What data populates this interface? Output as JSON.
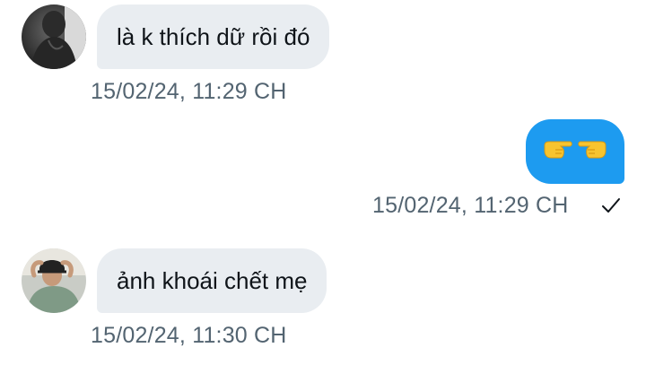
{
  "messages": [
    {
      "direction": "incoming",
      "text": "là k thích dữ rồi đó",
      "timestamp": "15/02/24, 11:29 CH",
      "avatar": "avatar-photo"
    },
    {
      "direction": "outgoing",
      "text": "",
      "emojis": [
        "backhand-index-pointing-right-icon",
        "backhand-index-pointing-left-icon"
      ],
      "timestamp": "15/02/24, 11:29 CH",
      "status": "check-icon"
    },
    {
      "direction": "incoming",
      "text": "ảnh khoái chết mẹ",
      "timestamp": "15/02/24, 11:30 CH",
      "avatar": "avatar-photo"
    }
  ],
  "colors": {
    "incoming_bubble": "#e9edf1",
    "outgoing_bubble": "#1d9bf0",
    "timestamp": "#536471",
    "text": "#0f1419"
  }
}
